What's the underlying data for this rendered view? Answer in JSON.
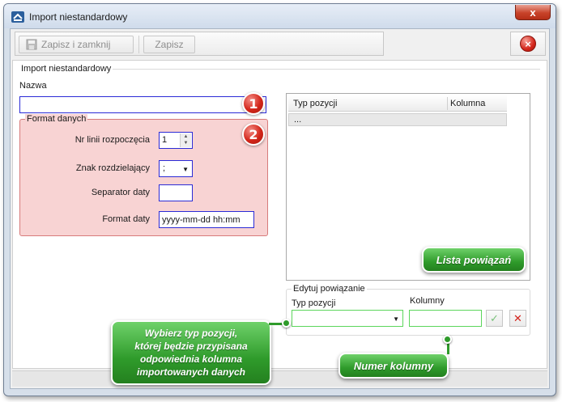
{
  "window": {
    "title": "Import niestandardowy",
    "close_glyph": "x"
  },
  "toolbar": {
    "save_close_label": "Zapisz i zamknij",
    "save_label": "Zapisz",
    "close_glyph": "×"
  },
  "main": {
    "group_title": "Import niestandardowy",
    "name_label": "Nazwa",
    "name_value": "",
    "badges": [
      "1",
      "2"
    ]
  },
  "format": {
    "title": "Format danych",
    "start_line_label": "Nr linii rozpoczęcia",
    "start_line_value": "1",
    "delimiter_label": "Znak rozdzielający",
    "delimiter_value": ";",
    "date_sep_label": "Separator daty",
    "date_sep_value": "",
    "date_format_label": "Format daty",
    "date_format_value": "yyyy-mm-dd hh:mm"
  },
  "grid": {
    "columns": [
      "Typ pozycji",
      "Kolumna"
    ],
    "rows": [
      [
        "...",
        ""
      ]
    ]
  },
  "edit": {
    "title": "Edytuj powiązanie",
    "type_label": "Typ pozycji",
    "column_label": "Kolumny",
    "ok_glyph": "✓",
    "delete_glyph": "✕"
  },
  "callouts": {
    "list": "Lista powiązań",
    "choose_type": [
      "Wybierz typ pozycji,",
      "której będzie przypisana",
      "odpowiednia kolumna",
      "importowanych danych"
    ],
    "column_number": "Numer kolumny"
  },
  "icons": {
    "app": "import-icon",
    "save": "disk-icon",
    "close": "red-x-icon",
    "ok": "check-icon",
    "delete": "x-icon"
  },
  "colors": {
    "callout_green": "#2f9b2b",
    "badge_red": "#d3261a",
    "format_bg": "#f8d3d3",
    "input_border_blue": "#2b2bd6",
    "input_border_green": "#5cd65c"
  }
}
